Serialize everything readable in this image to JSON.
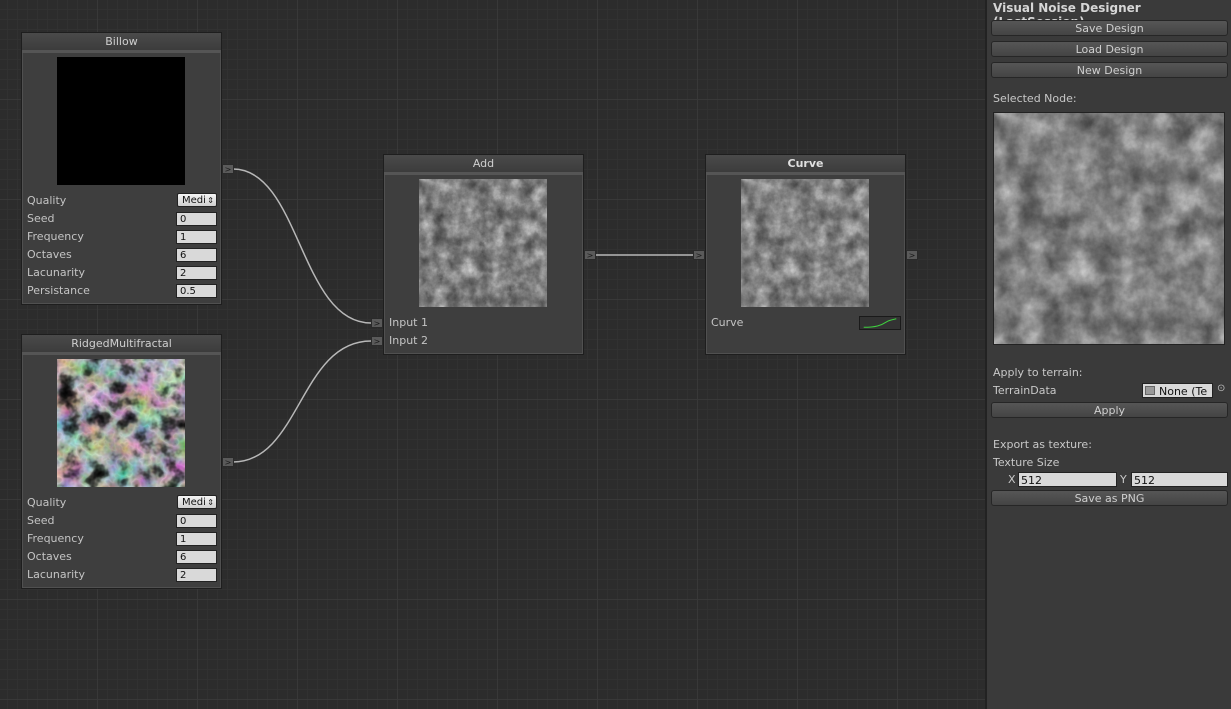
{
  "graph": {
    "billow": {
      "title": "Billow",
      "quality_label": "Quality",
      "quality_value": "Medi",
      "params": [
        {
          "label": "Seed",
          "value": "0"
        },
        {
          "label": "Frequency",
          "value": "1"
        },
        {
          "label": "Octaves",
          "value": "6"
        },
        {
          "label": "Lacunarity",
          "value": "2"
        },
        {
          "label": "Persistance",
          "value": "0.5"
        }
      ]
    },
    "ridged": {
      "title": "RidgedMultifractal",
      "quality_label": "Quality",
      "quality_value": "Medi",
      "params": [
        {
          "label": "Seed",
          "value": "0"
        },
        {
          "label": "Frequency",
          "value": "1"
        },
        {
          "label": "Octaves",
          "value": "6"
        },
        {
          "label": "Lacunarity",
          "value": "2"
        }
      ]
    },
    "add": {
      "title": "Add",
      "input1": "Input 1",
      "input2": "Input 2"
    },
    "curve": {
      "title": "Curve",
      "curve_label": "Curve"
    },
    "port_glyph": ">"
  },
  "panel": {
    "title": "Visual Noise Designer (LastSession)",
    "save_design": "Save Design",
    "load_design": "Load Design",
    "new_design": "New Design",
    "selected_node": "Selected Node:",
    "apply_to_terrain": "Apply to terrain:",
    "terrain_data_label": "TerrainData",
    "terrain_data_value": "None (Te",
    "apply": "Apply",
    "export_as_texture": "Export as texture:",
    "texture_size": "Texture Size",
    "x_label": "X",
    "x_value": "512",
    "y_label": "Y",
    "y_value": "512",
    "save_png": "Save as PNG"
  },
  "colors": {
    "curve_line": "#3fd13f",
    "wire": "#b8b8b8"
  }
}
